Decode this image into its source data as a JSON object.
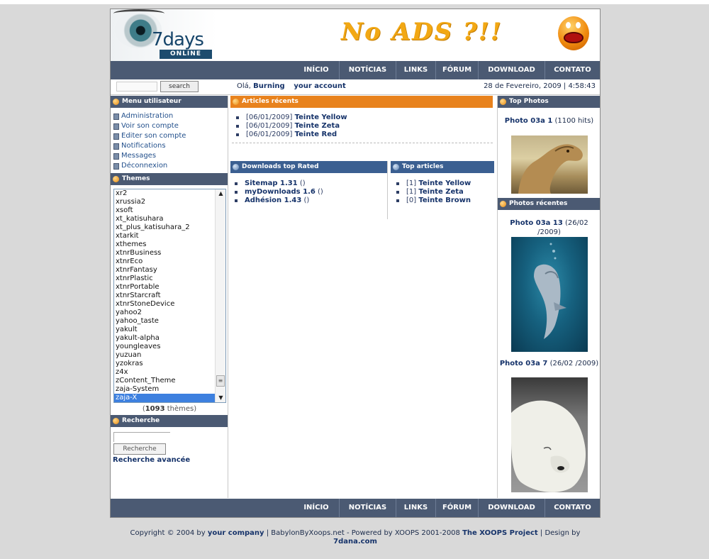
{
  "site": {
    "logo_text": "7days",
    "logo_sub": "ONLINE",
    "banner_text": "No ADS ?!!"
  },
  "nav": {
    "items": [
      "INÍCIO",
      "NOTÍCIAS",
      "LINKS",
      "FÓRUM",
      "DOWNLOAD",
      "CONTATO"
    ]
  },
  "search": {
    "button_label": "search",
    "value": ""
  },
  "greeting": {
    "hello": "Olá,",
    "user": "Burning",
    "account_link": "your account"
  },
  "datetime": "28 de Fevereiro, 2009 | 4:58:43",
  "user_menu": {
    "title": "Menu utilisateur",
    "items": [
      "Administration",
      "Voir son compte",
      "Editer son compte",
      "Notifications",
      "Messages",
      "Déconnexion"
    ]
  },
  "themes": {
    "title": "Themes",
    "options": [
      "xr2",
      "xrussia2",
      "xsoft",
      "xt_katisuhara",
      "xt_plus_katisuhara_2",
      "xtarkit",
      "xthemes",
      "xtnrBusiness",
      "xtnrEco",
      "xtnrFantasy",
      "xtnrPlastic",
      "xtnrPortable",
      "xtnrStarcraft",
      "xtnrStoneDevice",
      "yahoo2",
      "yahoo_taste",
      "yakult",
      "yakult-alpha",
      "youngleaves",
      "yuzuan",
      "yzokras",
      "z4x",
      "zContent_Theme",
      "zaja-System",
      "zaja-X"
    ],
    "selected": "zaja-X",
    "count_open": "(",
    "count": "1093",
    "count_label": " thèmes)"
  },
  "recherche": {
    "title": "Recherche",
    "input_value": "",
    "button_label": "Recherche",
    "advanced_link": "Recherche avancée"
  },
  "articles_recents": {
    "title": "Articles récents",
    "items": [
      {
        "date": "[06/01/2009]",
        "title": "Teinte Yellow"
      },
      {
        "date": "[06/01/2009]",
        "title": "Teinte Zeta"
      },
      {
        "date": "[06/01/2009]",
        "title": "Teinte Red"
      }
    ]
  },
  "downloads": {
    "title": "Downloads top Rated",
    "items": [
      {
        "name": "Sitemap 1.31",
        "extra": "()"
      },
      {
        "name": "myDownloads 1.6",
        "extra": "()"
      },
      {
        "name": "Adhésion 1.43",
        "extra": "()"
      }
    ]
  },
  "top_articles": {
    "title": "Top articles",
    "items": [
      {
        "count": "[1]",
        "title": "Teinte Yellow"
      },
      {
        "count": "[1]",
        "title": "Teinte Zeta"
      },
      {
        "count": "[0]",
        "title": "Teinte Brown"
      }
    ]
  },
  "top_photos": {
    "title": "Top Photos",
    "photo": {
      "name": "Photo 03a 1",
      "meta": "(1100 hits)"
    }
  },
  "recent_photos": {
    "title": "Photos récentes",
    "photos": [
      {
        "name": "Photo 03a 13",
        "meta": "(26/02 /2009)"
      },
      {
        "name": "Photo 03a 7",
        "meta": "(26/02 /2009)"
      }
    ]
  },
  "footer": {
    "copyright": "Copyright © 2004 by",
    "company": "your company",
    "sep1": " | BabylonByXoops.net - Powered by XOOPS 2001-2008",
    "xoops": "The XOOPS Project",
    "design": " | Design by",
    "designer": "7dana.com"
  },
  "colors": {
    "nav_bg": "#4b5a73",
    "orange_title": "#e8821d",
    "blue_title": "#3b5f91",
    "link": "#16336a",
    "selected": "#3d80df"
  }
}
